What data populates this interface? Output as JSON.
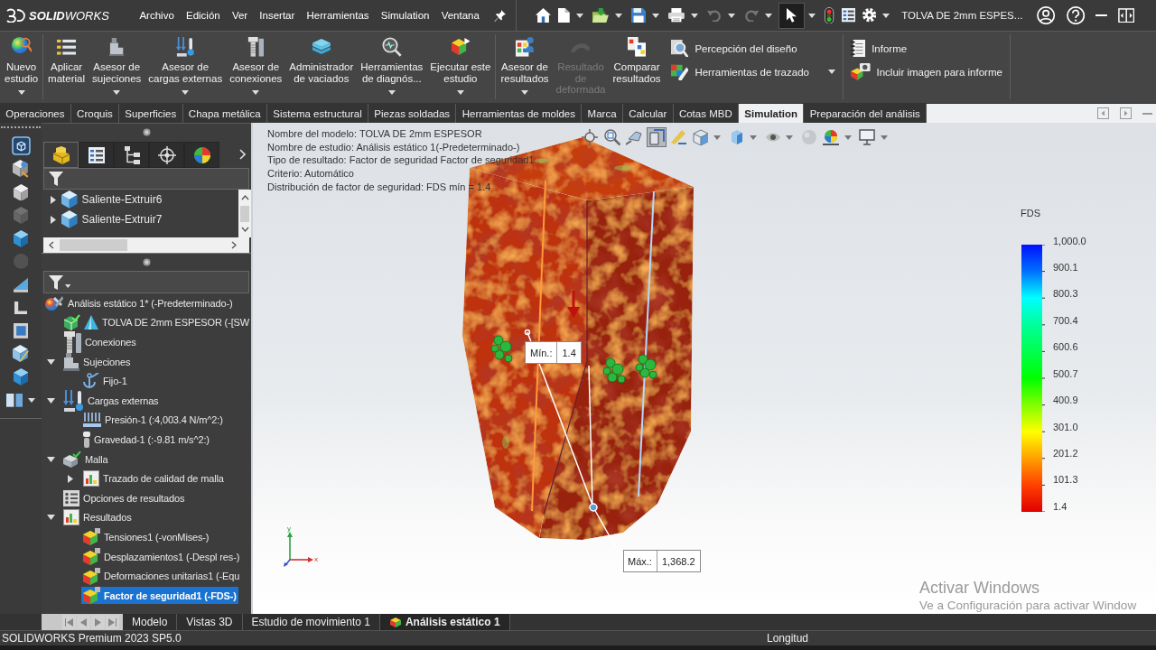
{
  "title_bar": {
    "logo": "**SOLID**WORKS",
    "menu": [
      "Archivo",
      "Edición",
      "Ver",
      "Insertar",
      "Herramientas",
      "Simulation",
      "Ventana"
    ],
    "quick_access": [
      {
        "dropdown": false,
        "disabled": false
      },
      {
        "dropdown": true,
        "disabled": false
      },
      {
        "dropdown": true,
        "disabled": false
      },
      {
        "dropdown": true,
        "disabled": false
      },
      {
        "dropdown": true,
        "disabled": false
      },
      {
        "dropdown": true,
        "disabled": true
      },
      {
        "dropdown": true,
        "disabled": true
      },
      {
        "dropdown": true,
        "disabled": false,
        "on": true
      },
      {
        "dropdown": false,
        "disabled": false
      },
      {
        "dropdown": false,
        "disabled": false
      },
      {
        "dropdown": true,
        "disabled": false
      }
    ],
    "document_title": "TOLVA DE 2mm ESPES..."
  },
  "ribbon": {
    "groups": [
      {
        "buttons": [
          {
            "label": "Nuevo\nestudio",
            "dropdown": true,
            "disabled": false
          }
        ]
      },
      {
        "buttons": [
          {
            "label": "Aplicar\nmaterial",
            "dropdown": false,
            "disabled": false
          },
          {
            "label": "Asesor de\nsujeciones",
            "dropdown": true,
            "disabled": false
          },
          {
            "label": "Asesor de\ncargas externas",
            "dropdown": true,
            "disabled": false
          },
          {
            "label": "Asesor de\nconexiones",
            "dropdown": true,
            "disabled": false
          },
          {
            "label": "Administrador\nde vaciados",
            "dropdown": false,
            "disabled": false
          },
          {
            "label": "Herramientas\nde diagnós...",
            "dropdown": true,
            "disabled": false
          },
          {
            "label": "Ejecutar este\nestudio",
            "dropdown": true,
            "disabled": false
          }
        ]
      },
      {
        "buttons": [
          {
            "label": "Asesor de\nresultados",
            "dropdown": true,
            "disabled": false
          },
          {
            "label": "Resultado\nde\ndeformada",
            "dropdown": false,
            "disabled": true
          },
          {
            "label": "Comparar\nresultados",
            "dropdown": false,
            "disabled": false
          }
        ],
        "stacked": [
          {
            "label": "Percepción del diseño",
            "dropdown": false
          },
          {
            "label": "Herramientas de trazado",
            "dropdown": true
          }
        ]
      },
      {
        "stacked": [
          {
            "label": "Informe",
            "dropdown": false
          },
          {
            "label": "Incluir imagen para informe",
            "dropdown": false
          }
        ]
      }
    ]
  },
  "command_tabs": [
    {
      "label": "Operaciones",
      "selected": false
    },
    {
      "label": "Croquis",
      "selected": false
    },
    {
      "label": "Superficies",
      "selected": false
    },
    {
      "label": "Chapa metálica",
      "selected": false
    },
    {
      "label": "Sistema estructural",
      "selected": false
    },
    {
      "label": "Piezas soldadas",
      "selected": false
    },
    {
      "label": "Herramientas de moldes",
      "selected": false
    },
    {
      "label": "Marca",
      "selected": false
    },
    {
      "label": "Calcular",
      "selected": false
    },
    {
      "label": "Cotas MBD",
      "selected": false
    },
    {
      "label": "Simulation",
      "selected": true
    },
    {
      "label": "Preparación del análisis",
      "selected": false
    }
  ],
  "task_pane": [
    {
      "disabled": false,
      "dropdown": false
    },
    {
      "disabled": false,
      "dropdown": false
    },
    {
      "disabled": false,
      "dropdown": false
    },
    {
      "disabled": true,
      "dropdown": false
    },
    {
      "disabled": false,
      "dropdown": false
    },
    {
      "disabled": true,
      "dropdown": false
    },
    {
      "disabled": false,
      "dropdown": false
    },
    {
      "disabled": false,
      "dropdown": false
    },
    {
      "disabled": false,
      "dropdown": false
    },
    {
      "disabled": false,
      "dropdown": false
    },
    {
      "disabled": false,
      "dropdown": false
    },
    {
      "disabled": false,
      "dropdown": true
    }
  ],
  "feature_manager": {
    "tabs": [
      {
        "selected": true
      },
      {
        "selected": false
      },
      {
        "selected": false
      },
      {
        "selected": false
      },
      {
        "selected": false
      }
    ],
    "items": [
      {
        "label": "Saliente-Extruir6",
        "expanded": false
      },
      {
        "label": "Saliente-Extruir7",
        "expanded": false
      }
    ]
  },
  "study_tree": [
    {
      "label": "Análisis estático 1* (-Predeterminado-)",
      "selected": false,
      "children": [
        {
          "label": "TOLVA DE 2mm ESPESOR (-[SW",
          "selected": false
        },
        {
          "label": "Conexiones",
          "selected": false
        },
        {
          "label": "Sujeciones",
          "selected": false,
          "expanded": true,
          "children": [
            {
              "label": "Fijo-1",
              "selected": false
            }
          ]
        },
        {
          "label": "Cargas externas",
          "selected": false,
          "expanded": true,
          "children": [
            {
              "label": "Presión-1 (:4,003.4 N/m^2:)",
              "selected": false
            },
            {
              "label": "Gravedad-1 (:-9.81 m/s^2:)",
              "selected": false
            }
          ]
        },
        {
          "label": "Malla",
          "selected": false,
          "expanded": true,
          "children": [
            {
              "label": "Trazado de calidad de malla",
              "selected": false,
              "expanded": false
            }
          ]
        },
        {
          "label": "Opciones de resultados",
          "selected": false
        },
        {
          "label": "Resultados",
          "selected": false,
          "expanded": true,
          "children": [
            {
              "label": "Tensiones1 (-vonMises-)",
              "selected": false
            },
            {
              "label": "Desplazamientos1 (-Despl res-)",
              "selected": false
            },
            {
              "label": "Deformaciones unitarias1 (-Equ",
              "selected": false
            },
            {
              "label": "Factor de seguridad1 (-FDS-)",
              "selected": true
            }
          ]
        }
      ]
    }
  ],
  "viewport": {
    "info_lines": [
      "Nombre del modelo: TOLVA DE 2mm ESPESOR",
      "Nombre de estudio: Análisis estático 1(-Predeterminado-)",
      "Tipo de resultado: Factor de seguridad Factor de seguridad1",
      "Criterio: Automático",
      "Distribución de factor de seguridad: FDS mín = 1.4"
    ],
    "view_tools": [
      {
        "dropdown": false,
        "on": false,
        "disabled": false
      },
      {
        "dropdown": false,
        "on": false,
        "disabled": false
      },
      {
        "dropdown": false,
        "on": false,
        "disabled": false
      },
      {
        "dropdown": false,
        "on": true,
        "disabled": false
      },
      {
        "dropdown": false,
        "on": false,
        "disabled": false
      },
      {
        "dropdown": true,
        "on": false,
        "disabled": false
      },
      {
        "dropdown": true,
        "on": false,
        "disabled": false
      },
      {
        "dropdown": true,
        "on": false,
        "disabled": false
      },
      {
        "dropdown": false,
        "on": false,
        "disabled": true
      },
      {
        "dropdown": true,
        "on": false,
        "disabled": false
      },
      {
        "dropdown": true,
        "on": false,
        "disabled": false
      }
    ],
    "probes": [
      {
        "label": "Mín.:",
        "value": "1.4"
      },
      {
        "label": "Máx.:",
        "value": "1,368.2"
      }
    ],
    "axis_labels": [
      "y",
      "x"
    ],
    "legend": {
      "title": "FDS",
      "labels": [
        "1,000.0",
        "900.1",
        "800.3",
        "700.4",
        "600.6",
        "500.7",
        "400.9",
        "301.0",
        "201.2",
        "101.3",
        "1.4"
      ]
    }
  },
  "activation_notice": {
    "title": "Activar Windows",
    "message": "Ve a Configuración para activar Window"
  },
  "bottom_tabs": [
    {
      "label": "Modelo",
      "selected": false
    },
    {
      "label": "Vistas 3D",
      "selected": false
    },
    {
      "label": "Estudio de movimiento 1",
      "selected": false
    },
    {
      "label": "Análisis estático 1",
      "selected": true
    }
  ],
  "status_bar": {
    "product": "SOLIDWORKS Premium 2023 SP5.0",
    "measure": "Longitud"
  }
}
